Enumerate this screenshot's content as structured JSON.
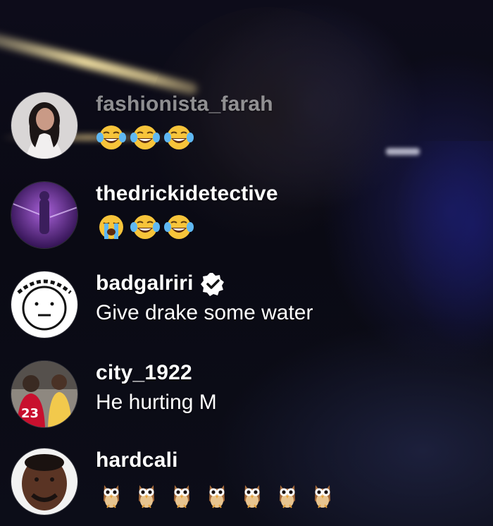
{
  "comments": [
    {
      "username": "fashionista_farah",
      "text": "",
      "emojis": [
        "face-with-tears-of-joy",
        "face-with-tears-of-joy",
        "face-with-tears-of-joy"
      ]
    },
    {
      "username": "thedrickidetective",
      "text": "",
      "emojis": [
        "loudly-crying-face",
        "face-with-tears-of-joy",
        "face-with-tears-of-joy"
      ]
    },
    {
      "username": "badgalriri",
      "verified": true,
      "text": "Give drake some water",
      "emojis": []
    },
    {
      "username": "city_1922",
      "text": "He hurting M",
      "emojis": []
    },
    {
      "username": "hardcali",
      "text": "",
      "emojis": [
        "owl",
        "owl",
        "owl",
        "owl",
        "owl",
        "owl",
        "owl"
      ]
    }
  ]
}
